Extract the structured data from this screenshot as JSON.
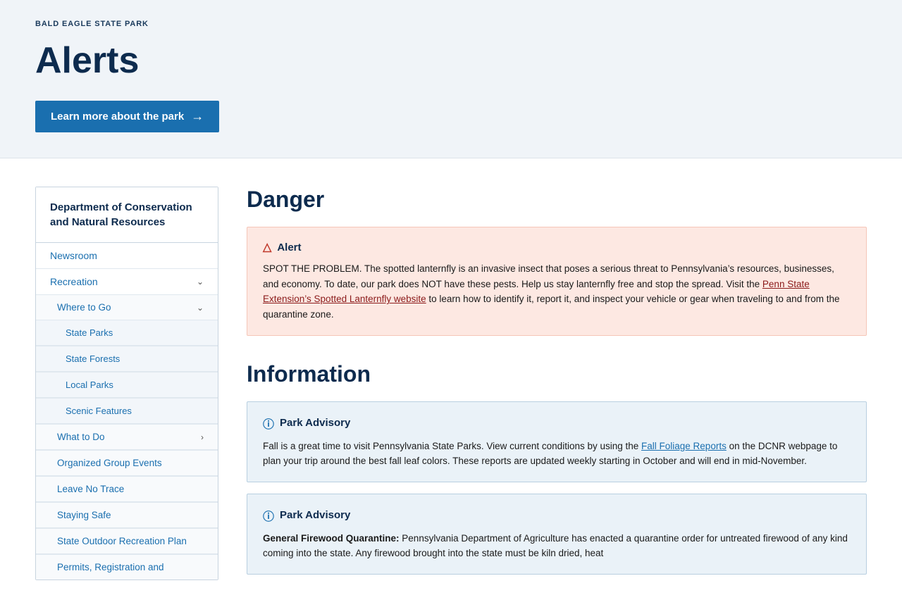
{
  "header": {
    "breadcrumb": "BALD EAGLE STATE PARK",
    "page_title": "Alerts",
    "learn_more_btn": "Learn more about the park"
  },
  "sidebar": {
    "title": "Department of Conservation and Natural Resources",
    "items": [
      {
        "id": "newsroom",
        "label": "Newsroom",
        "hasChevron": false,
        "expanded": false
      },
      {
        "id": "recreation",
        "label": "Recreation",
        "hasChevron": true,
        "expanded": true,
        "children": [
          {
            "id": "where-to-go",
            "label": "Where to Go",
            "hasChevron": true,
            "expanded": true,
            "children": [
              {
                "id": "state-parks",
                "label": "State Parks"
              },
              {
                "id": "state-forests",
                "label": "State Forests"
              },
              {
                "id": "local-parks",
                "label": "Local Parks"
              },
              {
                "id": "scenic-features",
                "label": "Scenic Features"
              }
            ]
          },
          {
            "id": "what-to-do",
            "label": "What to Do",
            "hasChevron": true,
            "expanded": false
          },
          {
            "id": "organized-group-events",
            "label": "Organized Group Events",
            "hasChevron": false
          },
          {
            "id": "leave-no-trace",
            "label": "Leave No Trace",
            "hasChevron": false
          },
          {
            "id": "staying-safe",
            "label": "Staying Safe",
            "hasChevron": false
          },
          {
            "id": "state-outdoor-recreation-plan",
            "label": "State Outdoor Recreation Plan",
            "hasChevron": false
          },
          {
            "id": "permits-registration",
            "label": "Permits, Registration and",
            "hasChevron": false
          }
        ]
      }
    ]
  },
  "content": {
    "danger_heading": "Danger",
    "alert_label": "Alert",
    "alert_text_before_link": "SPOT THE PROBLEM. The spotted lanternfly is an invasive insect that poses a serious threat to Pennsylvania’s resources, businesses, and economy. To date, our park does NOT have these pests. Help us stay lanternfly free and stop the spread. Visit the ",
    "alert_link_text": "Penn State Extension’s Spotted Lanternfly website",
    "alert_text_after_link": " to learn how to identify it, report it, and inspect your vehicle or gear when traveling to and from the quarantine zone.",
    "information_heading": "Information",
    "advisory1_label": "Park Advisory",
    "advisory1_text_before_link": "Fall is a great time to visit Pennsylvania State Parks. View current conditions by using the ",
    "advisory1_link_text": "Fall Foliage Reports",
    "advisory1_text_after_link": " on the DCNR webpage to plan your trip around the best fall leaf colors. These reports are updated weekly starting in October and will end in mid-November.",
    "advisory2_label": "Park Advisory",
    "advisory2_bold_text": "General Firewood Quarantine:",
    "advisory2_text": " Pennsylvania Department of Agriculture has enacted a quarantine order for untreated firewood of any kind coming into the state. Any firewood brought into the state must be kiln dried, heat"
  }
}
